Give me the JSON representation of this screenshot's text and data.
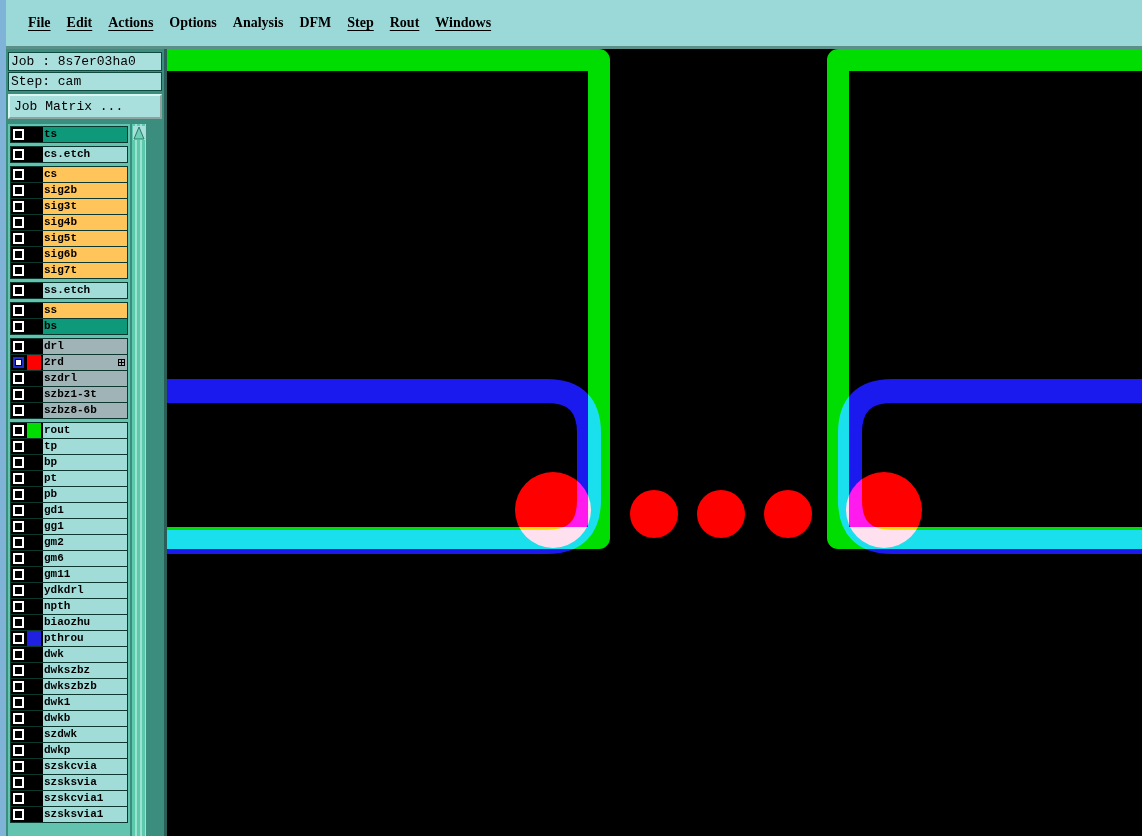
{
  "menu": [
    {
      "label": "File",
      "mnemonic": true
    },
    {
      "label": "Edit",
      "mnemonic": true
    },
    {
      "label": "Actions",
      "mnemonic": true
    },
    {
      "label": "Options",
      "mnemonic": false
    },
    {
      "label": "Analysis",
      "mnemonic": false
    },
    {
      "label": "DFM",
      "mnemonic": false
    },
    {
      "label": "Step",
      "mnemonic": true
    },
    {
      "label": "Rout",
      "mnemonic": true
    },
    {
      "label": "Windows",
      "mnemonic": true
    }
  ],
  "job": {
    "job_label": "Job : 8s7er03ha0",
    "step_label": "Step: cam",
    "matrix_button": "Job Matrix ..."
  },
  "layer_groups": [
    {
      "layers": [
        {
          "name": "ts",
          "kind": "mask",
          "selected": false,
          "flagged": false
        }
      ]
    },
    {
      "layers": [
        {
          "name": "cs.etch",
          "kind": "plain",
          "selected": false,
          "flagged": false
        }
      ]
    },
    {
      "layers": [
        {
          "name": "cs",
          "kind": "signal",
          "selected": false,
          "flagged": false
        },
        {
          "name": "sig2b",
          "kind": "signal",
          "selected": false,
          "flagged": false
        },
        {
          "name": "sig3t",
          "kind": "signal",
          "selected": false,
          "flagged": false
        },
        {
          "name": "sig4b",
          "kind": "signal",
          "selected": false,
          "flagged": false
        },
        {
          "name": "sig5t",
          "kind": "signal",
          "selected": false,
          "flagged": false
        },
        {
          "name": "sig6b",
          "kind": "signal",
          "selected": false,
          "flagged": false
        },
        {
          "name": "sig7t",
          "kind": "signal",
          "selected": false,
          "flagged": false
        }
      ]
    },
    {
      "layers": [
        {
          "name": "ss.etch",
          "kind": "plain",
          "selected": false,
          "flagged": false
        }
      ]
    },
    {
      "layers": [
        {
          "name": "ss",
          "kind": "signal",
          "selected": false,
          "flagged": false
        },
        {
          "name": "bs",
          "kind": "mask",
          "selected": false,
          "flagged": false
        }
      ]
    },
    {
      "layers": [
        {
          "name": "drl",
          "kind": "drill",
          "selected": false,
          "flagged": false
        },
        {
          "name": "2rd",
          "kind": "drill",
          "selected": true,
          "flagged": true,
          "color": "#ff0000"
        },
        {
          "name": "szdrl",
          "kind": "drill",
          "selected": false,
          "flagged": false
        },
        {
          "name": "szbz1-3t",
          "kind": "drill",
          "selected": false,
          "flagged": false
        },
        {
          "name": "szbz8-6b",
          "kind": "drill",
          "selected": false,
          "flagged": false
        }
      ]
    },
    {
      "layers": [
        {
          "name": "rout",
          "kind": "plain",
          "selected": false,
          "flagged": false,
          "color": "#00dd00"
        },
        {
          "name": "tp",
          "kind": "plain",
          "selected": false,
          "flagged": false
        },
        {
          "name": "bp",
          "kind": "plain",
          "selected": false,
          "flagged": false
        },
        {
          "name": "pt",
          "kind": "plain",
          "selected": false,
          "flagged": false
        },
        {
          "name": "pb",
          "kind": "plain",
          "selected": false,
          "flagged": false
        },
        {
          "name": "gd1",
          "kind": "plain",
          "selected": false,
          "flagged": false
        },
        {
          "name": "gg1",
          "kind": "plain",
          "selected": false,
          "flagged": false
        },
        {
          "name": "gm2",
          "kind": "plain",
          "selected": false,
          "flagged": false
        },
        {
          "name": "gm6",
          "kind": "plain",
          "selected": false,
          "flagged": false
        },
        {
          "name": "gm11",
          "kind": "plain",
          "selected": false,
          "flagged": false
        },
        {
          "name": "ydkdrl",
          "kind": "plain",
          "selected": false,
          "flagged": false
        },
        {
          "name": "npth",
          "kind": "plain",
          "selected": false,
          "flagged": false
        },
        {
          "name": "biaozhu",
          "kind": "plain",
          "selected": false,
          "flagged": false
        },
        {
          "name": "pthrou",
          "kind": "plain",
          "selected": false,
          "flagged": false,
          "color": "#2020e0"
        },
        {
          "name": "dwk",
          "kind": "plain",
          "selected": false,
          "flagged": false
        },
        {
          "name": "dwkszbz",
          "kind": "plain",
          "selected": false,
          "flagged": false
        },
        {
          "name": "dwkszbzb",
          "kind": "plain",
          "selected": false,
          "flagged": false
        },
        {
          "name": "dwk1",
          "kind": "plain",
          "selected": false,
          "flagged": false
        },
        {
          "name": "dwkb",
          "kind": "plain",
          "selected": false,
          "flagged": false
        },
        {
          "name": "szdwk",
          "kind": "plain",
          "selected": false,
          "flagged": false
        },
        {
          "name": "dwkp",
          "kind": "plain",
          "selected": false,
          "flagged": false
        },
        {
          "name": "szskcvia",
          "kind": "plain",
          "selected": false,
          "flagged": false
        },
        {
          "name": "szsksvia",
          "kind": "plain",
          "selected": false,
          "flagged": false
        },
        {
          "name": "szskcvia1",
          "kind": "plain",
          "selected": false,
          "flagged": false
        },
        {
          "name": "szsksvia1",
          "kind": "plain",
          "selected": false,
          "flagged": false
        }
      ]
    }
  ]
}
